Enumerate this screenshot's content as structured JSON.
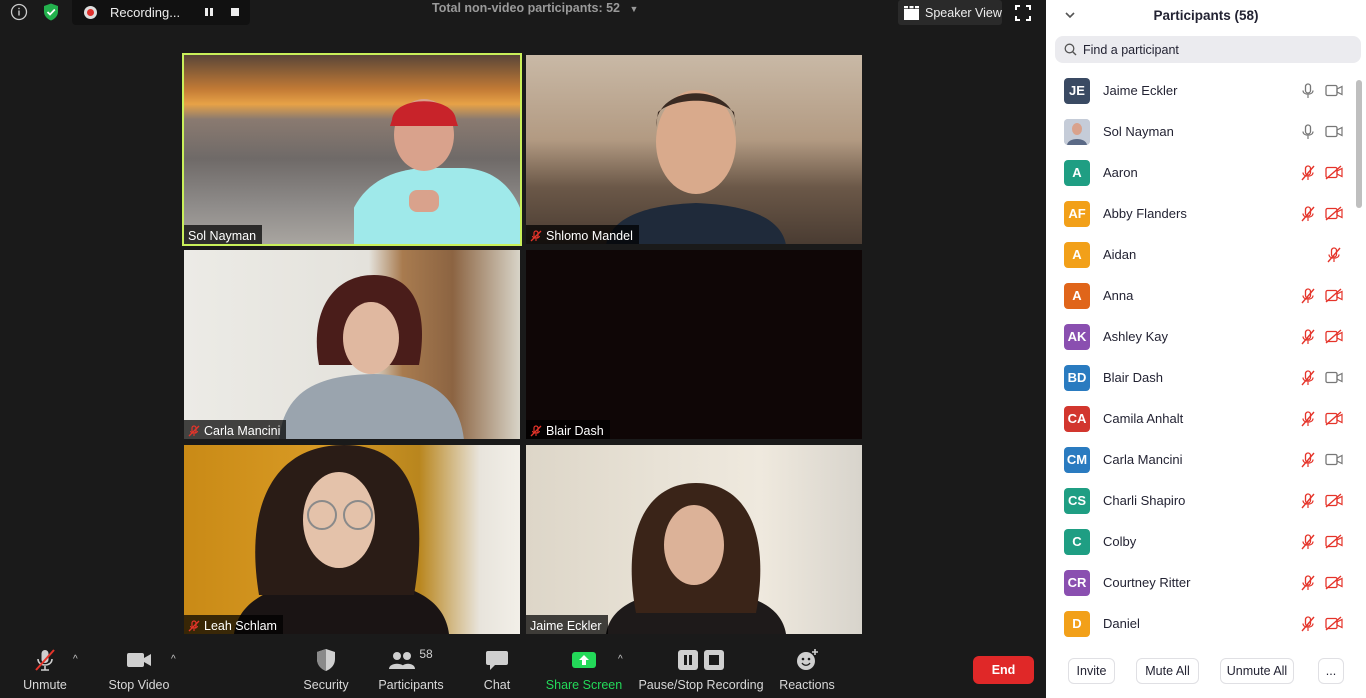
{
  "topbar": {
    "recording_label": "Recording...",
    "total_non_video": "Total non-video participants: 52",
    "speaker_view": "Speaker View"
  },
  "tiles": [
    {
      "name": "Sol Nayman",
      "muted": false,
      "active": true
    },
    {
      "name": "Shlomo Mandel",
      "muted": true,
      "active": false
    },
    {
      "name": "Carla Mancini",
      "muted": true,
      "active": false
    },
    {
      "name": "Blair Dash",
      "muted": true,
      "active": false
    },
    {
      "name": "Leah Schlam",
      "muted": true,
      "active": false
    },
    {
      "name": "Jaime Eckler",
      "muted": false,
      "active": false
    }
  ],
  "toolbar": {
    "unmute": "Unmute",
    "stop_video": "Stop Video",
    "security": "Security",
    "participants": "Participants",
    "participants_count": "58",
    "chat": "Chat",
    "share_screen": "Share Screen",
    "pause_stop_recording": "Pause/Stop Recording",
    "reactions": "Reactions",
    "end": "End"
  },
  "panel": {
    "title": "Participants (58)",
    "search_placeholder": "Find a participant",
    "participants": [
      {
        "initials": "JE",
        "name": "Jaime Eckler",
        "color": "#3a4a63",
        "mic": "on",
        "cam": "on"
      },
      {
        "initials": "",
        "name": "Sol Nayman",
        "color": "#c5ccd8",
        "mic": "on",
        "cam": "on",
        "photo": true
      },
      {
        "initials": "A",
        "name": "Aaron",
        "color": "#1f9e83",
        "mic": "off",
        "cam": "off"
      },
      {
        "initials": "AF",
        "name": "Abby Flanders",
        "color": "#f2a019",
        "mic": "off",
        "cam": "off"
      },
      {
        "initials": "A",
        "name": "Aidan",
        "color": "#f2a019",
        "mic": "off",
        "cam": "none"
      },
      {
        "initials": "A",
        "name": "Anna",
        "color": "#e0651a",
        "mic": "off",
        "cam": "off"
      },
      {
        "initials": "AK",
        "name": "Ashley Kay",
        "color": "#8a4fb0",
        "mic": "off",
        "cam": "off"
      },
      {
        "initials": "BD",
        "name": "Blair Dash",
        "color": "#2a7bc0",
        "mic": "off",
        "cam": "on"
      },
      {
        "initials": "CA",
        "name": "Camila Anhalt",
        "color": "#d2362e",
        "mic": "off",
        "cam": "off"
      },
      {
        "initials": "CM",
        "name": "Carla Mancini",
        "color": "#2a7bc0",
        "mic": "off",
        "cam": "on"
      },
      {
        "initials": "CS",
        "name": "Charli Shapiro",
        "color": "#1f9e83",
        "mic": "off",
        "cam": "off"
      },
      {
        "initials": "C",
        "name": "Colby",
        "color": "#1f9e83",
        "mic": "off",
        "cam": "off"
      },
      {
        "initials": "CR",
        "name": "Courtney Ritter",
        "color": "#8a4fb0",
        "mic": "off",
        "cam": "off"
      },
      {
        "initials": "D",
        "name": "Daniel",
        "color": "#f2a019",
        "mic": "off",
        "cam": "off"
      }
    ],
    "footer": {
      "invite": "Invite",
      "mute_all": "Mute All",
      "unmute_all": "Unmute All",
      "more": "..."
    }
  },
  "colors": {
    "active_speaker": "#c9f05a",
    "end_button": "#e02828",
    "share_screen": "#23d959",
    "muted_red": "#e5342a"
  }
}
